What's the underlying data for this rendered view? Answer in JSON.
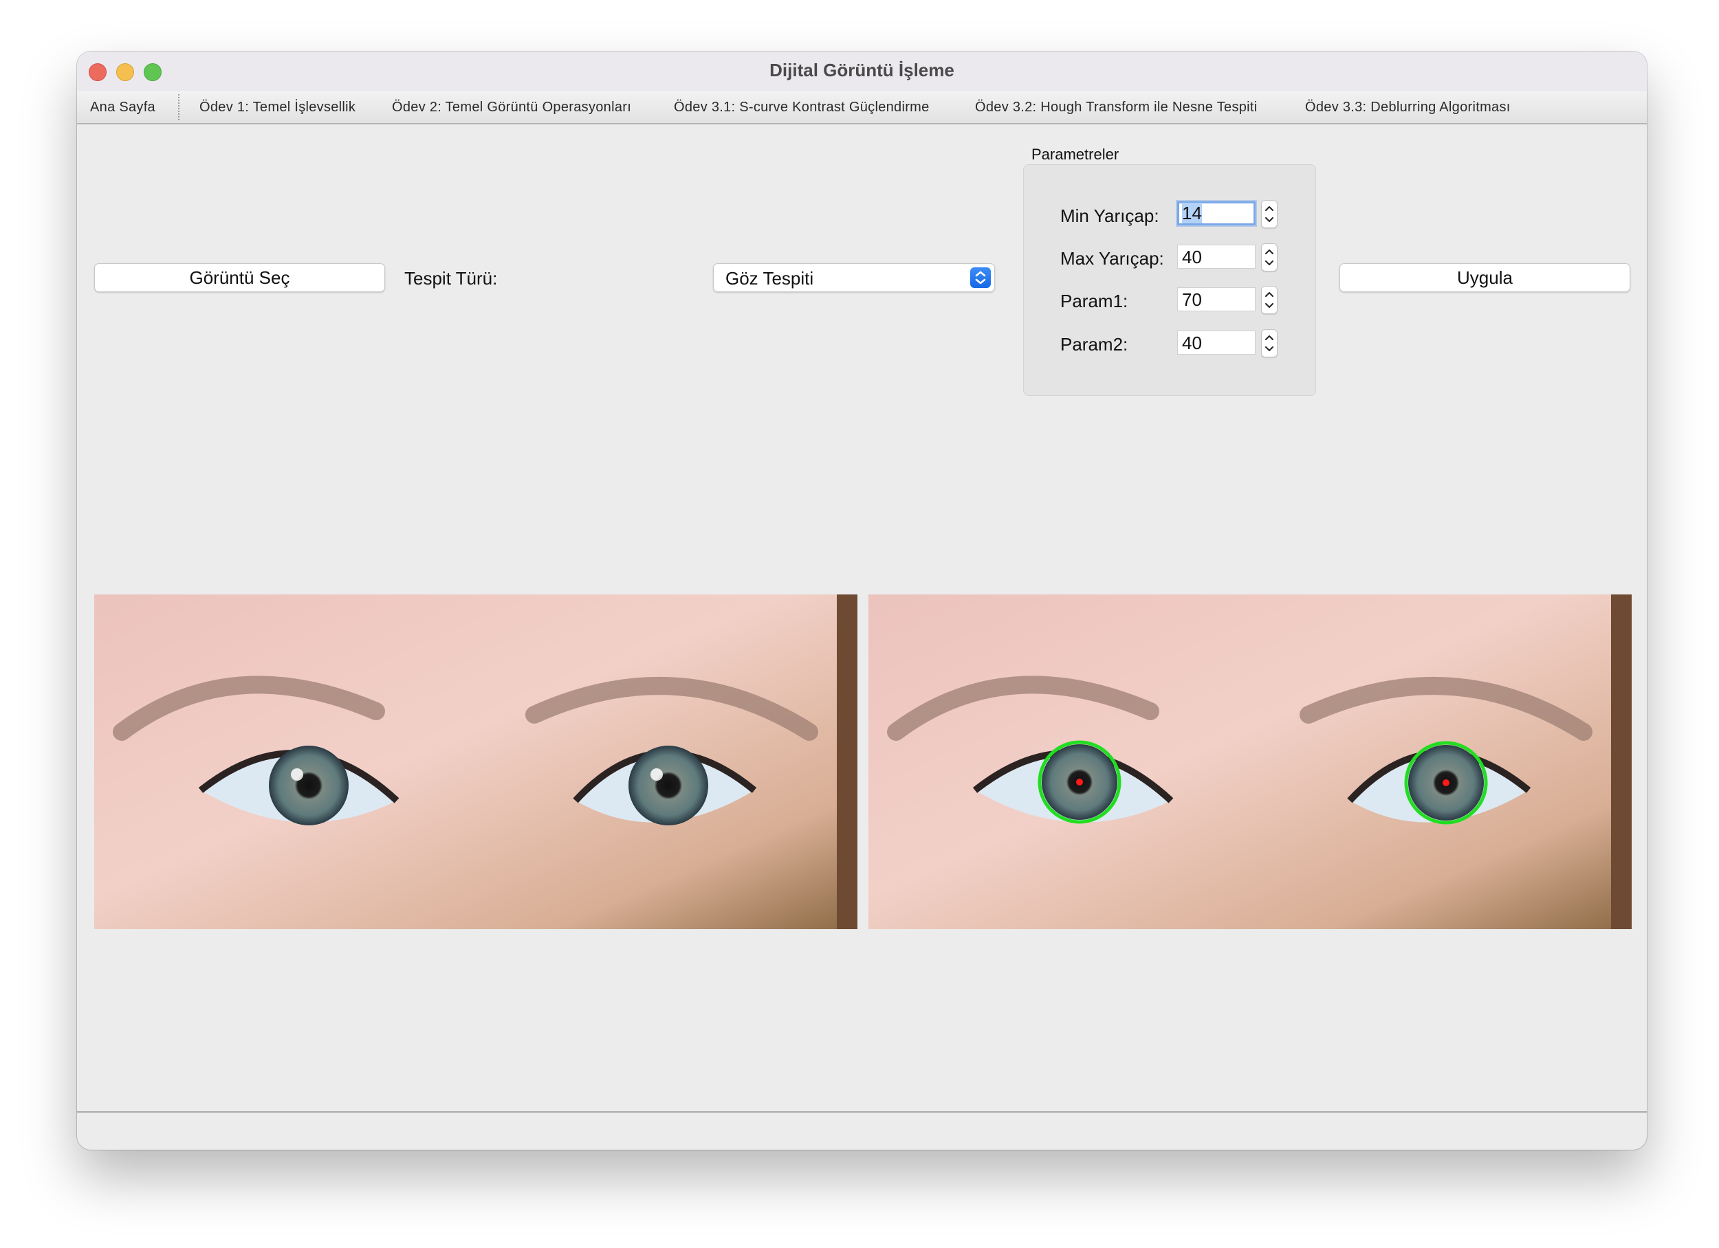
{
  "window": {
    "title": "Dijital Görüntü İşleme"
  },
  "tabs": [
    "Ana Sayfa",
    "Ödev 1: Temel İşlevsellik",
    "Ödev 2: Temel Görüntü Operasyonları",
    "Ödev 3.1: S-curve Kontrast Güçlendirme",
    "Ödev 3.2: Hough Transform ile Nesne Tespiti",
    "Ödev 3.3: Deblurring Algoritması"
  ],
  "controls": {
    "select_image_label": "Görüntü Seç",
    "detection_type_label": "Tespit Türü:",
    "detection_type_value": "Göz Tespiti",
    "apply_label": "Uygula"
  },
  "parameters": {
    "caption": "Parametreler",
    "items": [
      {
        "label": "Min Yarıçap:",
        "value": "14"
      },
      {
        "label": "Max Yarıçap:",
        "value": "40"
      },
      {
        "label": "Param1:",
        "value": "70"
      },
      {
        "label": "Param2:",
        "value": "40"
      }
    ]
  },
  "colors": {
    "detection_circle": "#22dd22",
    "detection_center": "#ff1a1a",
    "accent_blue": "#1f76ee"
  }
}
